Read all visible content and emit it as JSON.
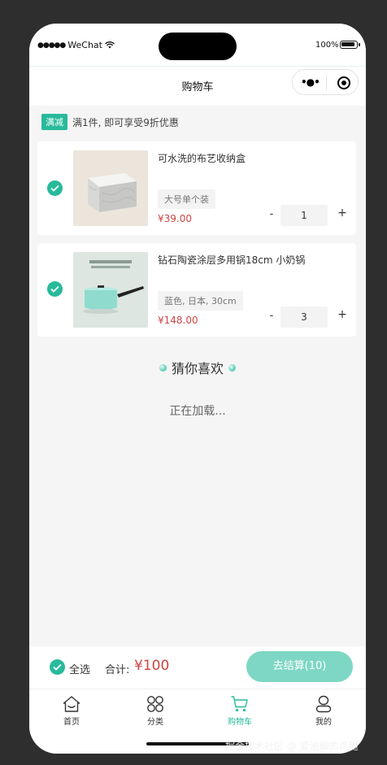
{
  "status_bar": {
    "carrier": "WeChat",
    "battery": "100%"
  },
  "nav": {
    "title": "购物车"
  },
  "promo": {
    "tag": "满减",
    "text": "满1件, 即可享受9折优惠"
  },
  "cart_items": [
    {
      "name": "可水洗的布艺收纳盒",
      "attr": "大号单个装",
      "price": "¥39.00",
      "quantity": "1",
      "minus": "-",
      "plus": "+"
    },
    {
      "name": "钻石陶瓷涂层多用锅18cm 小奶锅",
      "attr": "蓝色, 日本, 30cm",
      "price": "¥148.00",
      "quantity": "3",
      "minus": "-",
      "plus": "+"
    }
  ],
  "guess": {
    "title": "猜你喜欢"
  },
  "loading": "正在加载...",
  "bottom_bar": {
    "select_all": "全选",
    "total_label": "合计:",
    "total_value": "¥100",
    "checkout": "去结算(10)"
  },
  "tabs": [
    {
      "label": "首页",
      "icon": "home-icon"
    },
    {
      "label": "分类",
      "icon": "category-icon"
    },
    {
      "label": "购物车",
      "icon": "cart-icon"
    },
    {
      "label": "我的",
      "icon": "user-icon"
    }
  ],
  "watermark": "掘金技术社区 @ 爱泡脚的鸡腿",
  "colors": {
    "accent": "#27ba9b",
    "price": "#cf4444",
    "checkout_bg": "#7ed7c4"
  }
}
